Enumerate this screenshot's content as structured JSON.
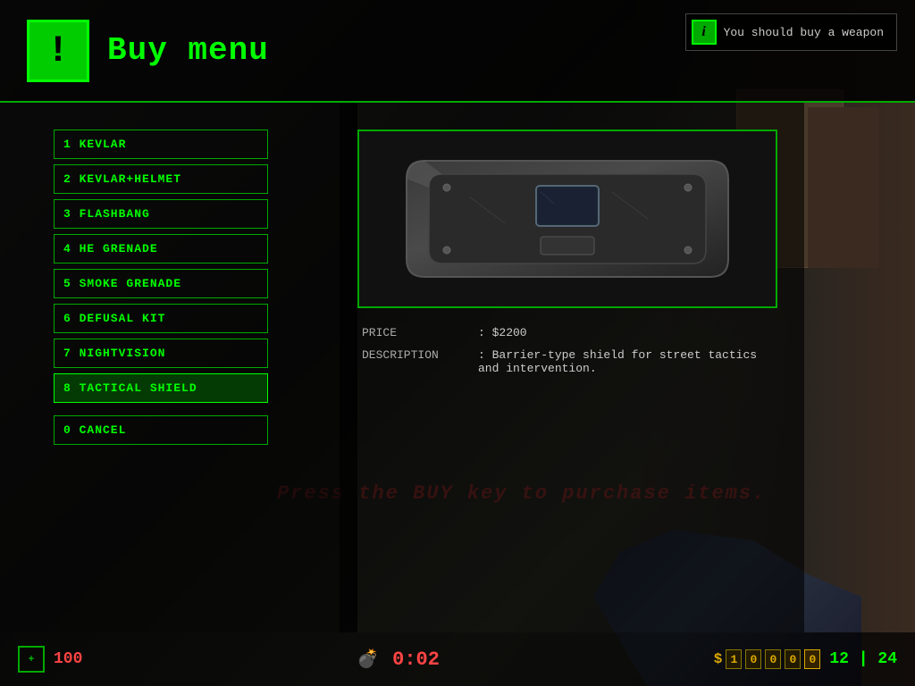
{
  "header": {
    "icon_label": "!",
    "title": "Buy menu"
  },
  "notification": {
    "icon": "i",
    "message": "You should buy a weapon"
  },
  "menu": {
    "items": [
      {
        "id": 1,
        "label": "1 KEVLAR",
        "active": false
      },
      {
        "id": 2,
        "label": "2 KEVLAR+HELMET",
        "active": false
      },
      {
        "id": 3,
        "label": "3 FLASHBANG",
        "active": false
      },
      {
        "id": 4,
        "label": "4 HE GRENADE",
        "active": false
      },
      {
        "id": 5,
        "label": "5 SMOKE GRENADE",
        "active": false
      },
      {
        "id": 6,
        "label": "6 DEFUSAL KIT",
        "active": false
      },
      {
        "id": 7,
        "label": "7 NIGHTVISION",
        "active": false
      },
      {
        "id": 8,
        "label": "8 TACTICAL SHIELD",
        "active": true
      }
    ],
    "cancel_label": "0 CANCEL"
  },
  "detail": {
    "price_label": "PRICE",
    "price_value": ": $2200",
    "description_label": "DESCRIPTION",
    "description_value": ": Barrier-type shield for street tactics and intervention."
  },
  "bg_text": "Press the BUY key to purchase items.",
  "hud": {
    "health": "100",
    "timer": "0:02",
    "money": "$10000",
    "ammo_main": "12",
    "ammo_reserve": "24"
  }
}
